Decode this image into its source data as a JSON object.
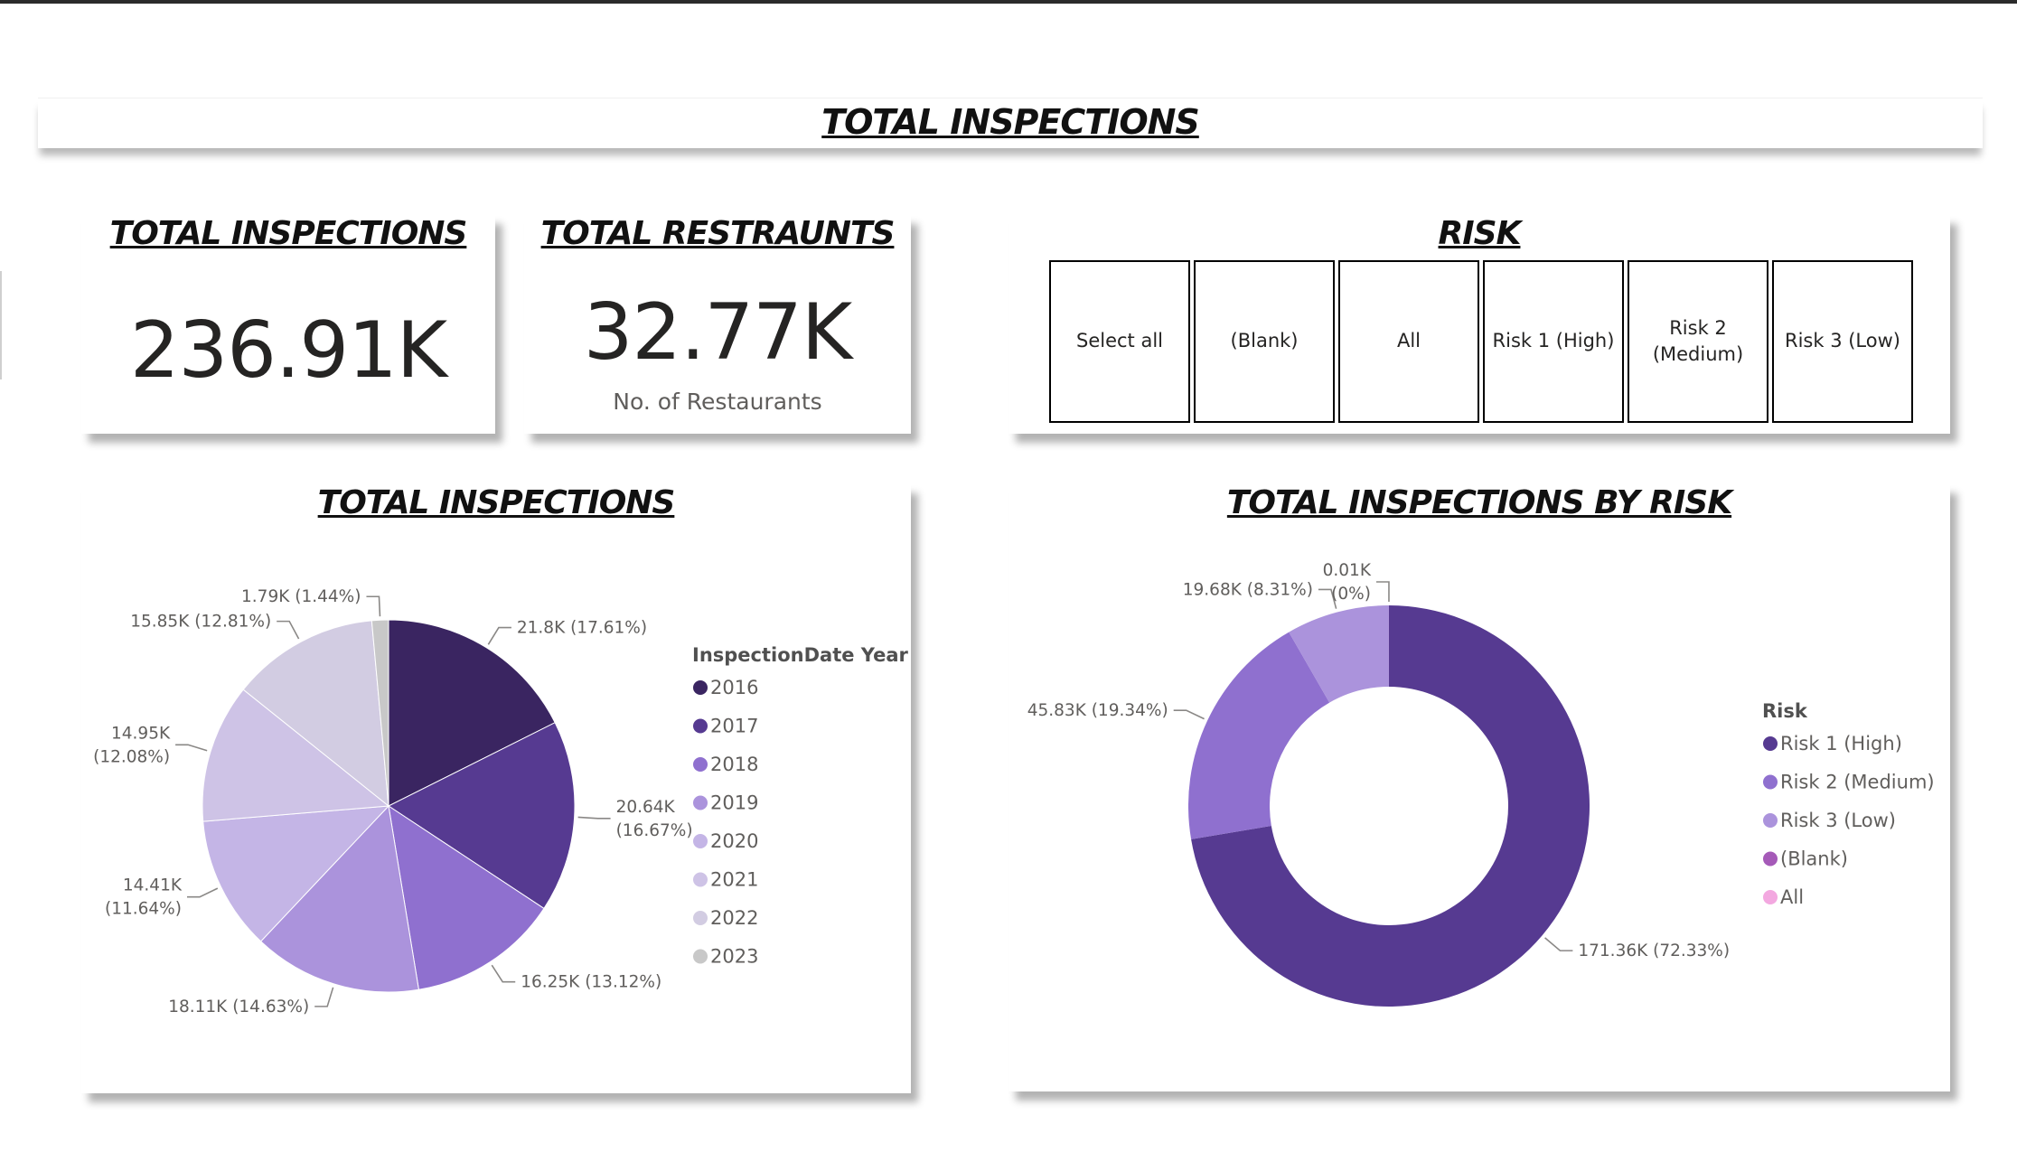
{
  "header": {
    "title": "TOTAL INSPECTIONS"
  },
  "kpi_inspections": {
    "title": "TOTAL INSPECTIONS",
    "value": "236.91K"
  },
  "kpi_restaurants": {
    "title": "TOTAL RESTRAUNTS",
    "value": "32.77K",
    "label": "No. of Restaurants"
  },
  "risk_slicer": {
    "title": "RISK",
    "options": [
      "Select all",
      "(Blank)",
      "All",
      "Risk 1 (High)",
      "Risk 2\n(Medium)",
      "Risk 3 (Low)"
    ]
  },
  "pie_card": {
    "title": "TOTAL INSPECTIONS"
  },
  "donut_card": {
    "title": "TOTAL INSPECTIONS BY RISK"
  },
  "chart_data": [
    {
      "type": "pie",
      "title": "TOTAL INSPECTIONS",
      "legend_title": "InspectionDate Year",
      "legend_position": "right",
      "categories": [
        "2016",
        "2017",
        "2018",
        "2019",
        "2020",
        "2021",
        "2022",
        "2023"
      ],
      "values": [
        21.8,
        20.64,
        16.25,
        18.11,
        14.41,
        14.95,
        15.85,
        1.79
      ],
      "percents": [
        17.61,
        16.67,
        13.12,
        14.63,
        11.64,
        12.08,
        12.81,
        1.44
      ],
      "data_labels": [
        "21.8K (17.61%)",
        "20.64K\n(16.67%)",
        "16.25K (13.12%)",
        "18.11K (14.63%)",
        "14.41K\n(11.64%)",
        "14.95K\n(12.08%)",
        "15.85K (12.81%)",
        "1.79K (1.44%)"
      ],
      "colors": [
        "#3a2561",
        "#563a91",
        "#8f70cf",
        "#ab93dc",
        "#c4b5e6",
        "#cec3e6",
        "#d2cce2",
        "#c8c8c8"
      ]
    },
    {
      "type": "pie",
      "subtype": "donut",
      "title": "TOTAL INSPECTIONS BY RISK",
      "legend_title": "Risk",
      "legend_position": "right",
      "categories": [
        "Risk 1 (High)",
        "Risk 2 (Medium)",
        "Risk 3 (Low)",
        "(Blank)",
        "All"
      ],
      "values": [
        171.36,
        45.83,
        19.68,
        0.01,
        0
      ],
      "percents": [
        72.33,
        19.34,
        8.31,
        0,
        0
      ],
      "data_labels": [
        "171.36K (72.33%)",
        "45.83K (19.34%)",
        "19.68K (8.31%)",
        "0.01K\n(0%)",
        ""
      ],
      "colors": [
        "#563a91",
        "#8f70cf",
        "#ab93dc",
        "#a55ab8",
        "#f3a8e0"
      ]
    }
  ]
}
